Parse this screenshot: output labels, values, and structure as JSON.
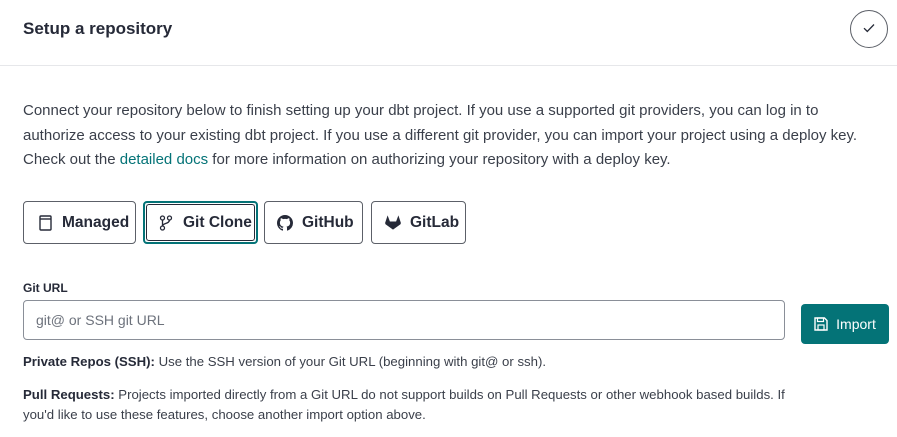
{
  "header": {
    "title": "Setup a repository",
    "complete_icon": "check-icon"
  },
  "intro": {
    "part1": "Connect your repository below to finish setting up your dbt project. If you use a supported git providers, you can log in to authorize access to your existing dbt project. If you use a different git provider, you can import your project using a deploy key. Check out the ",
    "link_text": "detailed docs",
    "part2": " for more information on authorizing your repository with a deploy key."
  },
  "options": [
    {
      "label": "Managed",
      "icon": "book-icon",
      "selected": false
    },
    {
      "label": "Git Clone",
      "icon": "git-branch-icon",
      "selected": true
    },
    {
      "label": "GitHub",
      "icon": "github-icon",
      "selected": false
    },
    {
      "label": "GitLab",
      "icon": "gitlab-icon",
      "selected": false
    }
  ],
  "git_url": {
    "label": "Git URL",
    "value": "",
    "placeholder": "git@ or SSH git URL"
  },
  "import_button": {
    "label": "Import",
    "icon": "save-icon"
  },
  "help": {
    "private_title": "Private Repos (SSH):",
    "private_text": " Use the SSH version of your Git URL (beginning with git@ or ssh).",
    "pull_title": "Pull Requests:",
    "pull_text": " Projects imported directly from a Git URL do not support builds on Pull Requests or other webhook based builds. If you'd like to use these features, choose another import option above."
  },
  "colors": {
    "accent": "#047377",
    "text": "#262a38",
    "border": "#5c6068"
  }
}
